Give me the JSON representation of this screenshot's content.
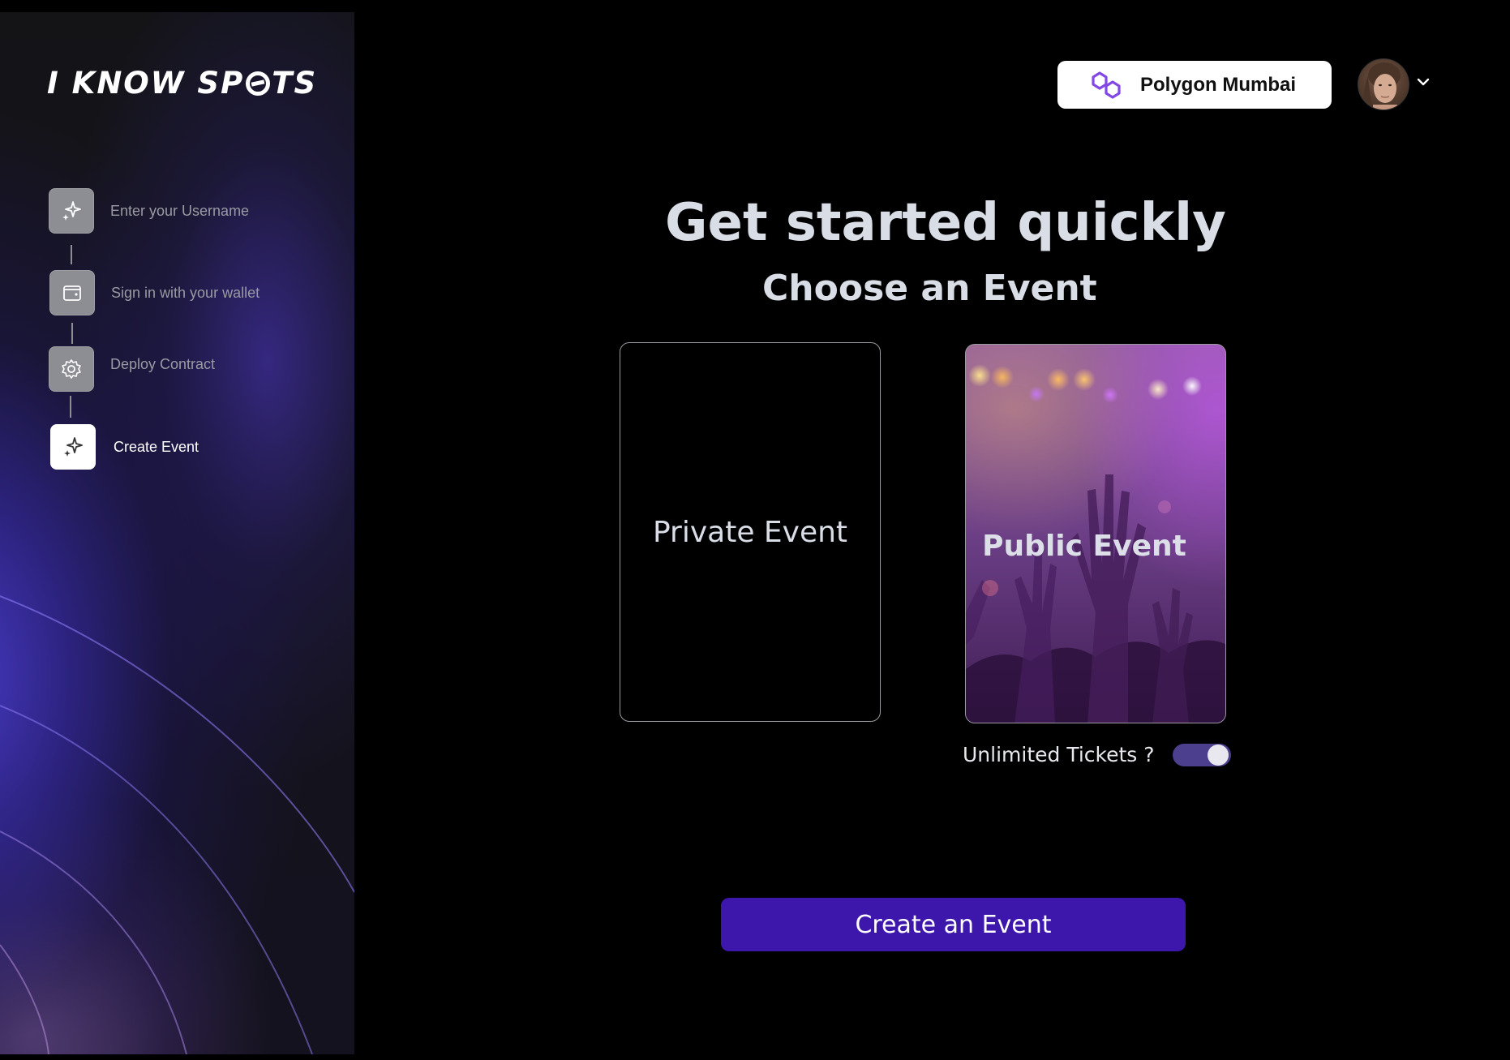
{
  "brand": {
    "logo_text_left": "I KNOW SP",
    "logo_text_right": "TS"
  },
  "steps": [
    {
      "label": "Enter your Username",
      "icon": "sparkle-icon",
      "active": false
    },
    {
      "label": "Sign in with your wallet",
      "icon": "wallet-icon",
      "active": false
    },
    {
      "label": "Deploy Contract",
      "icon": "gear-icon",
      "active": false
    },
    {
      "label": "Create Event",
      "icon": "sparkle-icon",
      "active": true
    }
  ],
  "header": {
    "network_label": "Polygon Mumbai",
    "network_icon": "polygon-icon",
    "avatar": "user-avatar",
    "menu_icon": "chevron-down-icon"
  },
  "main": {
    "title": "Get started quickly",
    "subtitle": "Choose an Event",
    "cards": [
      {
        "label": "Private Event"
      },
      {
        "label": "Public Event"
      }
    ],
    "toggle": {
      "label": "Unlimited Tickets ?",
      "on": true
    },
    "create_button": "Create an Event"
  },
  "colors": {
    "accent": "#3d16ab",
    "toggle_track": "#4c3f8e",
    "network_brand": "#8247e5",
    "text_light": "#d8dde6"
  }
}
